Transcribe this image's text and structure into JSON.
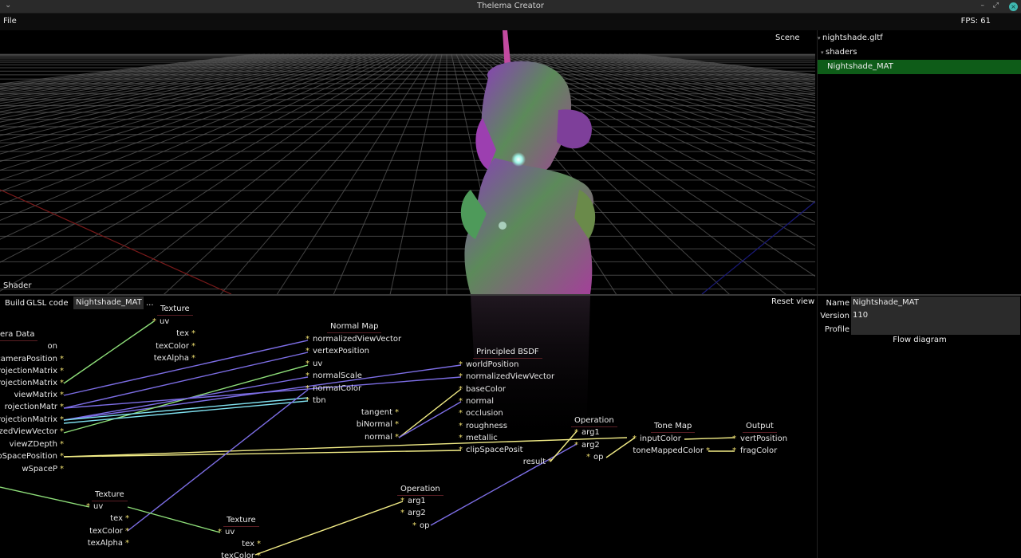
{
  "window": {
    "title": "Thelema Creator",
    "minimize": "–",
    "maximize": "⤢",
    "close": "×",
    "menu": "⌄"
  },
  "menubar": {
    "file": "File",
    "fps": "FPS: 61"
  },
  "viewport": {
    "scene_label": "Scene",
    "shader_label": "Shader"
  },
  "tree": {
    "items": [
      {
        "label": "nightshade.gltf",
        "expander": "▾"
      },
      {
        "label": "shaders",
        "expander": "▾"
      },
      {
        "label": "Nightshade_MAT",
        "selected": true
      }
    ]
  },
  "editor_toolbar": {
    "build": "Build",
    "glsl": "GLSL code",
    "material": "Nightshade_MAT",
    "more": "...",
    "reset_view": "Reset view"
  },
  "nodes": {
    "camera": {
      "title": "era Data",
      "pins": [
        "on",
        "cameraPosition",
        "ProjectionMatrix",
        "ProjectionMatrix",
        "viewMatrix",
        "rojectionMatr",
        "ProjectionMatrix",
        "lizedViewVector",
        "viewZDepth",
        "lipSpacePosition",
        "wSpaceP"
      ]
    },
    "texture1": {
      "title": "Texture",
      "pins": [
        "uv",
        "tex",
        "texColor",
        "texAlpha"
      ]
    },
    "normal_map": {
      "title": "Normal Map",
      "pins": [
        "normalizedViewVector",
        "vertexPosition",
        "uv",
        "normalScale",
        "normalColor",
        "tbn"
      ]
    },
    "attrs": {
      "pins": [
        "tangent",
        "biNormal",
        "normal"
      ]
    },
    "bsdf": {
      "title": "Principled BSDF",
      "pins": [
        "worldPosition",
        "normalizedViewVector",
        "baseColor",
        "normal",
        "occlusion",
        "roughness",
        "metallic",
        "clipSpacePosit"
      ],
      "result": "result"
    },
    "operation1": {
      "title": "Operation",
      "pins": [
        "arg1",
        "arg2",
        "op"
      ]
    },
    "tonemap": {
      "title": "Tone Map",
      "pins": [
        "inputColor",
        "toneMappedColor"
      ]
    },
    "output": {
      "title": "Output",
      "pins": [
        "vertPosition",
        "fragColor"
      ]
    },
    "texture2": {
      "title": "Texture",
      "pins": [
        "uv",
        "tex",
        "texColor",
        "texAlpha"
      ]
    },
    "texture3": {
      "title": "Texture",
      "pins": [
        "uv",
        "tex",
        "texColor"
      ]
    },
    "operation2": {
      "title": "Operation",
      "pins": [
        "arg1",
        "arg2",
        "op"
      ]
    }
  },
  "props": {
    "name_label": "Name",
    "name_value": "Nightshade_MAT",
    "version_label": "Version",
    "version_value": "110",
    "profile_label": "Profile",
    "profile_value": "",
    "flow": "Flow diagram"
  },
  "colors": {
    "selection": "#0e5c18",
    "wire_green": "#8fe07a",
    "wire_purple": "#7d6ee6",
    "wire_cyan": "#7fe0ef",
    "wire_yellow": "#f2ec86",
    "pin_star": "#f0e070"
  }
}
